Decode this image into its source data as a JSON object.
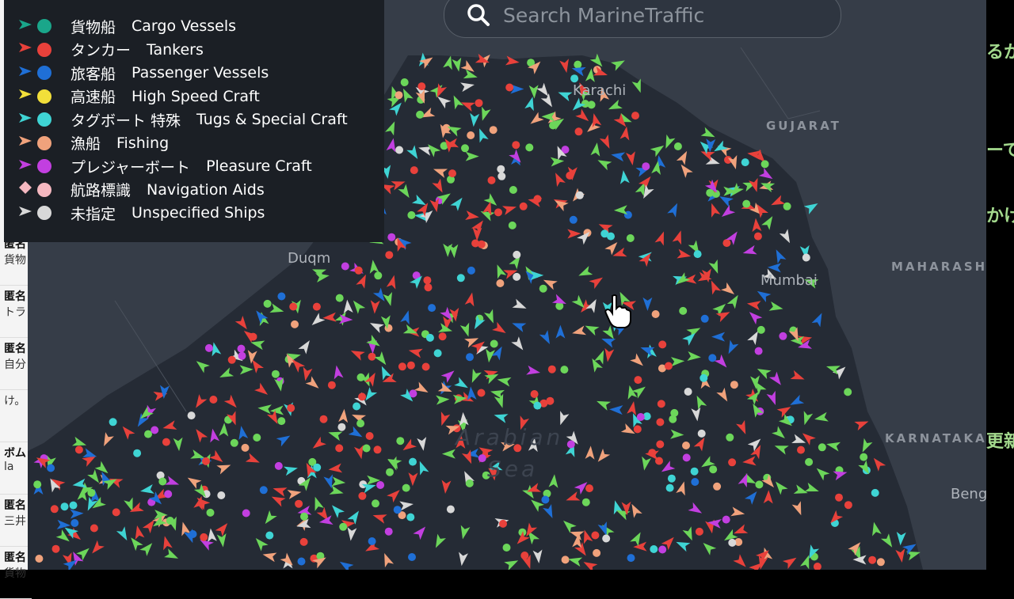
{
  "search": {
    "placeholder": "Search MarineTraffic"
  },
  "legend": [
    {
      "jp": "貨物船",
      "en": "Cargo Vessels",
      "color": "#1aa68a",
      "symbol": "arrow"
    },
    {
      "jp": "タンカー",
      "en": "Tankers",
      "color": "#e8413b",
      "symbol": "arrow"
    },
    {
      "jp": "旅客船",
      "en": "Passenger Vessels",
      "color": "#1f6fd6",
      "symbol": "arrow"
    },
    {
      "jp": "高速船",
      "en": "High Speed Craft",
      "color": "#f2df3a",
      "symbol": "arrow"
    },
    {
      "jp": "タグボート 特殊",
      "en": "Tugs & Special Craft",
      "color": "#3fd4d4",
      "symbol": "arrow"
    },
    {
      "jp": "漁船",
      "en": "Fishing",
      "color": "#f0a27c",
      "symbol": "arrow"
    },
    {
      "jp": "プレジャーボート",
      "en": "Pleasure Craft",
      "color": "#c23fe0",
      "symbol": "arrow"
    },
    {
      "jp": "航路標識",
      "en": "Navigation Aids",
      "color": "#f5b8c0",
      "symbol": "diamond"
    },
    {
      "jp": "未指定",
      "en": "Unspecified Ships",
      "color": "#d8d8d8",
      "symbol": "arrow"
    }
  ],
  "map_labels": {
    "gujarat": "GUJARAT",
    "maharashtra": "MAHARASHT",
    "karnataka": "KARNATAKA",
    "duqm": "Duqm",
    "mumbai": "Mumbai",
    "karachi": "Karachi",
    "bengaluru": "Beng",
    "sea": "Arabian",
    "sea2": "Sea"
  },
  "side_panel": [
    {
      "name": "匿名",
      "text": "貨物"
    },
    {
      "name": "匿名",
      "text": "トラ"
    },
    {
      "name": "匿名",
      "text": "自分"
    },
    {
      "name": "",
      "text": "け。"
    },
    {
      "name": "ボム",
      "text": "la"
    },
    {
      "name": "匿名",
      "text": "三井"
    },
    {
      "name": "匿名",
      "text": "貨物"
    }
  ],
  "right_strip": [
    "るか",
    "ーて",
    "かけ",
    "更新"
  ],
  "colors": {
    "map_bg": "#252b35",
    "land": "#363d48",
    "legend_bg": "#1b1f25",
    "cargo": "#6cd65a",
    "tanker": "#e8413b"
  }
}
